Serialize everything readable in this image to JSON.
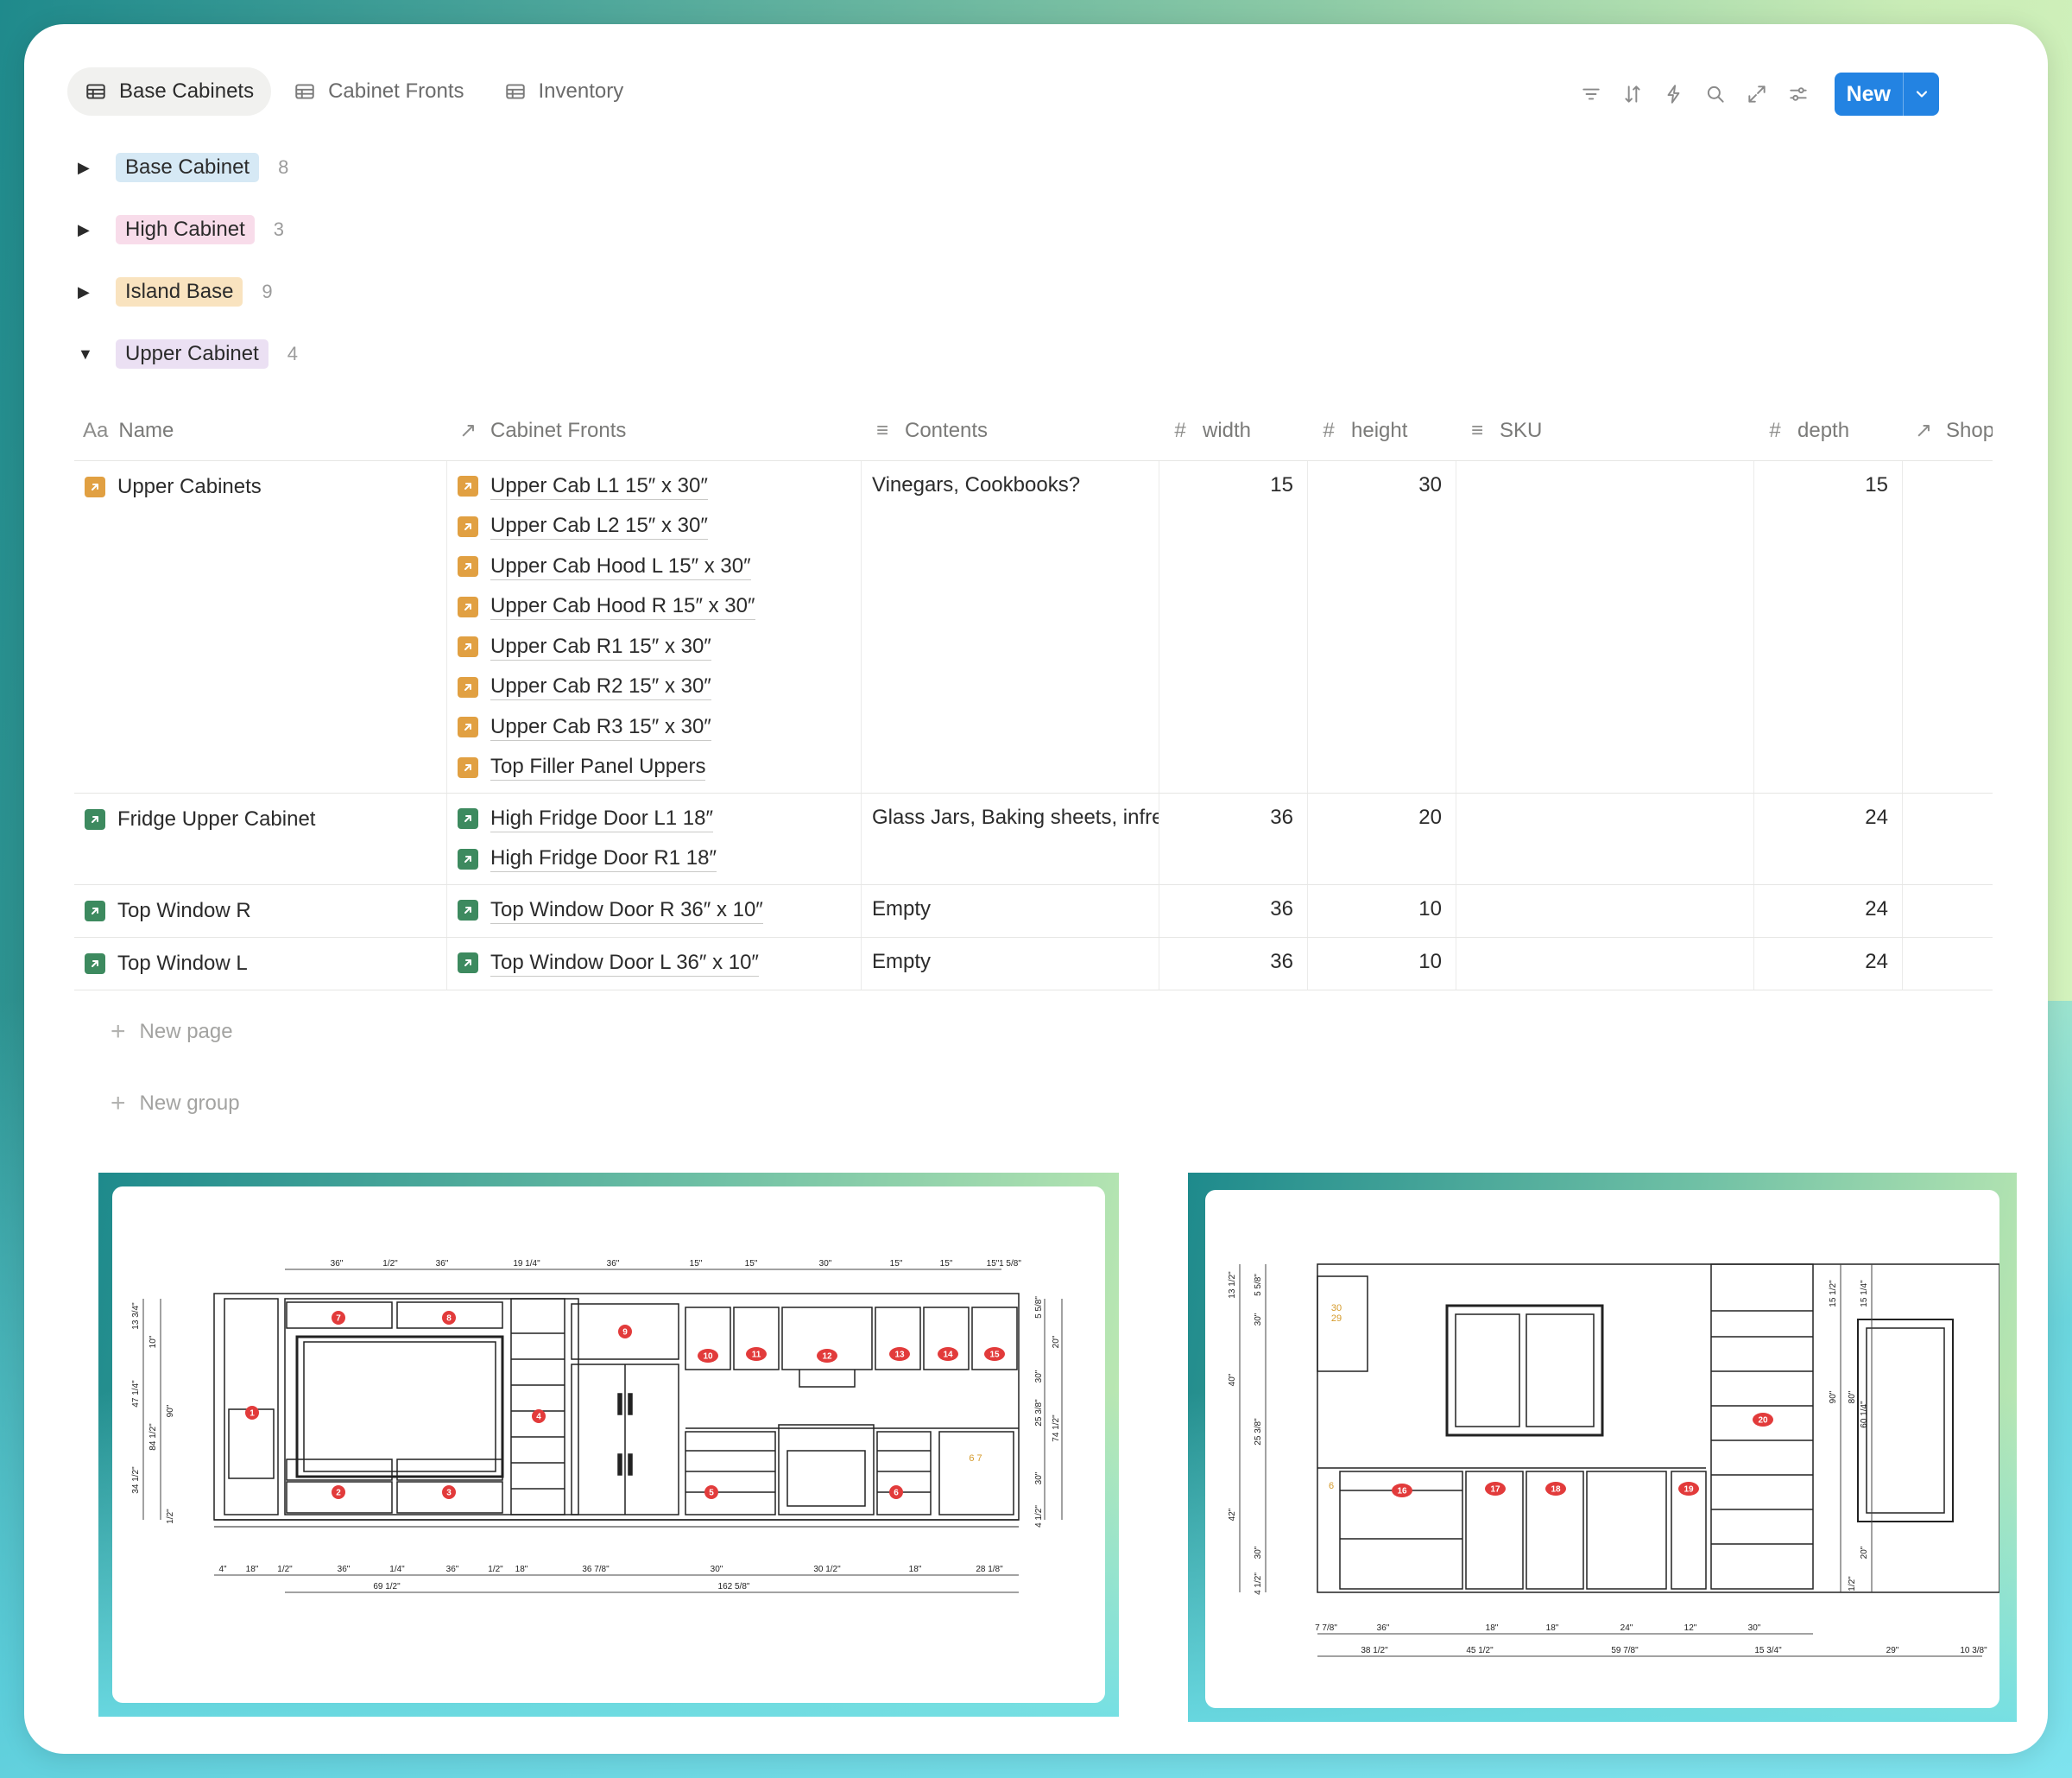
{
  "tabs": [
    {
      "label": "Base Cabinets",
      "active": true
    },
    {
      "label": "Cabinet Fronts",
      "active": false
    },
    {
      "label": "Inventory",
      "active": false
    }
  ],
  "toolbar": {
    "icons": [
      "filter-icon",
      "sort-icon",
      "automation-bolt-icon",
      "search-icon",
      "expand-icon",
      "settings-sliders-icon"
    ],
    "new_label": "New"
  },
  "groups": [
    {
      "label": "Base Cabinet",
      "count": "8",
      "expanded": false,
      "color": "#d6e9f5"
    },
    {
      "label": "High Cabinet",
      "count": "3",
      "expanded": false,
      "color": "#f8dcea"
    },
    {
      "label": "Island Base",
      "count": "9",
      "expanded": false,
      "color": "#f9e3bf"
    },
    {
      "label": "Upper Cabinet",
      "count": "4",
      "expanded": true,
      "color": "#ebe0f3"
    }
  ],
  "columns": {
    "name": "Name",
    "fronts": "Cabinet Fronts",
    "contents": "Contents",
    "width": "width",
    "height": "height",
    "sku": "SKU",
    "depth": "depth",
    "shop": "Shop"
  },
  "rows": [
    {
      "name": "Upper Cabinets",
      "icon_color": "orange",
      "fronts": [
        "Upper Cab L1 15″ x 30″",
        "Upper Cab L2 15″ x 30″",
        "Upper Cab Hood L 15″ x 30″",
        "Upper Cab Hood R 15″ x 30″",
        "Upper Cab R1 15″ x 30″",
        "Upper Cab R2 15″ x 30″",
        "Upper Cab R3 15″ x 30″",
        "Top Filler Panel Uppers"
      ],
      "front_color": "orange",
      "contents": "Vinegars, Cookbooks?",
      "width": "15",
      "height": "30",
      "sku": "",
      "depth": "15"
    },
    {
      "name": "Fridge Upper Cabinet",
      "icon_color": "green",
      "fronts": [
        "High Fridge Door L1 18″",
        "High Fridge Door R1 18″"
      ],
      "front_color": "green",
      "contents": "Glass Jars, Baking sheets, infrequent",
      "width": "36",
      "height": "20",
      "sku": "",
      "depth": "24"
    },
    {
      "name": "Top Window R",
      "icon_color": "green",
      "fronts": [
        "Top Window Door R 36″ x 10″"
      ],
      "front_color": "green",
      "contents": "Empty",
      "width": "36",
      "height": "10",
      "sku": "",
      "depth": "24"
    },
    {
      "name": "Top Window L",
      "icon_color": "green",
      "fronts": [
        "Top Window Door L 36″ x 10″"
      ],
      "front_color": "green",
      "contents": "Empty",
      "width": "36",
      "height": "10",
      "sku": "",
      "depth": "24"
    }
  ],
  "new_page": "New page",
  "new_group": "New group",
  "drawing_left": {
    "top_dims": [
      "36\"",
      "1/2\"",
      "36\"",
      "19 1/4\"",
      "36\"",
      "15\"",
      "15\"",
      "30\"",
      "15\"",
      "15\"",
      "15\"",
      "1 5/8\""
    ],
    "bottom_dims": [
      "4\"",
      "18\"",
      "1/2\"",
      "36\"",
      "1/4\"",
      "36\"",
      "1/2\"",
      "18\"",
      "36 7/8\"",
      "30\"",
      "30 1/2\"",
      "18\"",
      "28 1/8\""
    ],
    "bottom_totals": [
      "69 1/2\"",
      "162 5/8\""
    ],
    "left_dims": [
      "13 3/4\"",
      "10\"",
      "47 1/4\"",
      "84 1/2\"",
      "90\"",
      "34 1/2\"",
      "1/2\""
    ],
    "right_dims": [
      "5 5/8\"",
      "20\"",
      "30\"",
      "25 3/8\"",
      "74 1/2\"",
      "30\"",
      "4 1/2\""
    ],
    "markers": [
      "1",
      "2",
      "3",
      "4",
      "5",
      "6",
      "7",
      "8",
      "9",
      "10",
      "11",
      "12",
      "13",
      "14",
      "15"
    ],
    "note": "6 7"
  },
  "drawing_right": {
    "left_dims": [
      "13 1/2\"",
      "5 5/8\"",
      "30\"",
      "40\"",
      "25 3/8\"",
      "42\"",
      "30\"",
      "4 1/2\""
    ],
    "right_dims": [
      "15 1/2\"",
      "15 1/4\"",
      "90\"",
      "80\"",
      "60 1/4\"",
      "1/2\"",
      "20\""
    ],
    "bottom_dims": [
      "7 7/8\"",
      "36\"",
      "18\"",
      "18\"",
      "24\"",
      "12\"",
      "30\""
    ],
    "bottom_totals": [
      "38 1/2\"",
      "45 1/2\"",
      "59 7/8\"",
      "15 3/4\"",
      "29\"",
      "10 3/8\""
    ],
    "markers": [
      "16",
      "17",
      "18",
      "19",
      "20"
    ],
    "note_lines": [
      "30",
      "29"
    ],
    "side_note": "6"
  }
}
